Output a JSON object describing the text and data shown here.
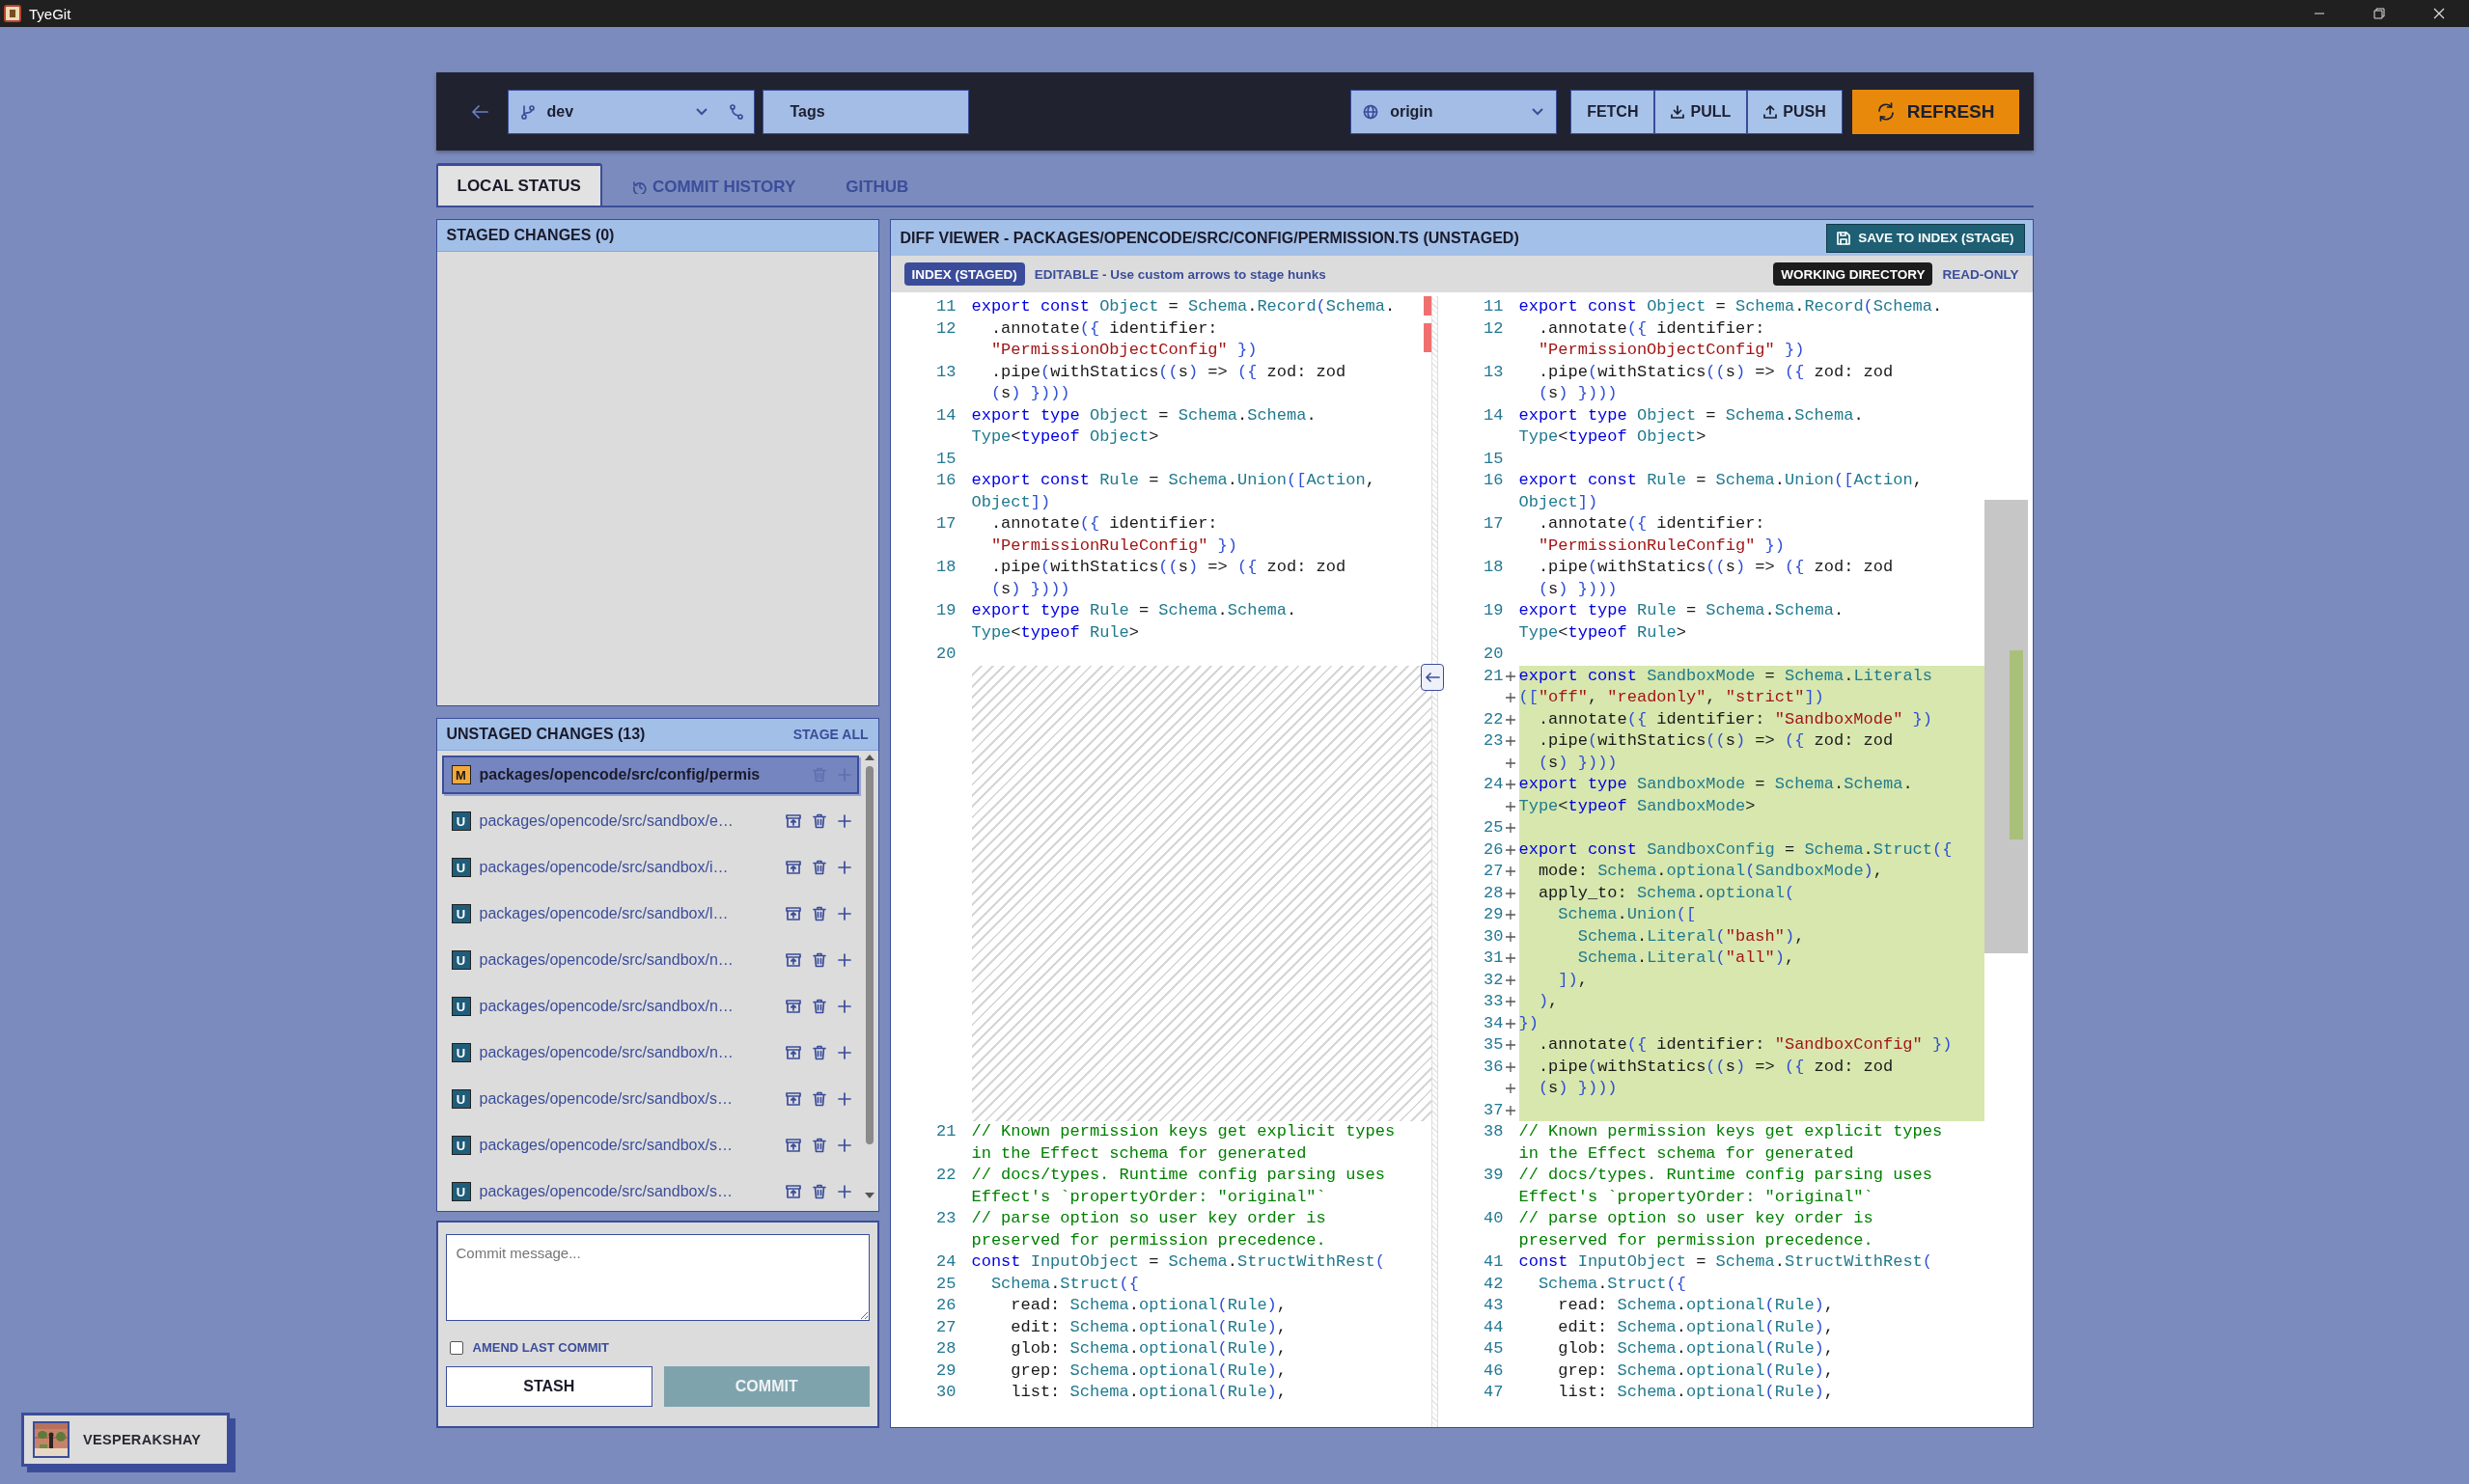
{
  "window": {
    "title": "TyeGit"
  },
  "toolbar": {
    "branch": "dev",
    "tags": "Tags",
    "remote": "origin",
    "actions": [
      {
        "label": "FETCH",
        "kind": "plain"
      },
      {
        "label": "PULL",
        "kind": "pull"
      },
      {
        "label": "PUSH",
        "kind": "push"
      },
      {
        "label": "REFRESH",
        "kind": "refresh"
      }
    ]
  },
  "tabs": [
    {
      "label": "LOCAL STATUS",
      "kind": "plain",
      "selected": true
    },
    {
      "label": "COMMIT HISTORY",
      "kind": "history",
      "selected": false
    },
    {
      "label": "GITHUB",
      "kind": "plain",
      "selected": false
    }
  ],
  "staged": {
    "title": "STAGED CHANGES (0)"
  },
  "unstaged": {
    "title": "UNSTAGED CHANGES (13)",
    "action": "STAGE ALL",
    "files": [
      {
        "status": "M",
        "kind": "modified",
        "path": "packages/opencode/src/config/permis",
        "selected": true
      },
      {
        "status": "U",
        "kind": "untracked",
        "path": "packages/opencode/src/sandbox/e…",
        "selected": false
      },
      {
        "status": "U",
        "kind": "untracked",
        "path": "packages/opencode/src/sandbox/i…",
        "selected": false
      },
      {
        "status": "U",
        "kind": "untracked",
        "path": "packages/opencode/src/sandbox/l…",
        "selected": false
      },
      {
        "status": "U",
        "kind": "untracked",
        "path": "packages/opencode/src/sandbox/n…",
        "selected": false
      },
      {
        "status": "U",
        "kind": "untracked",
        "path": "packages/opencode/src/sandbox/n…",
        "selected": false
      },
      {
        "status": "U",
        "kind": "untracked",
        "path": "packages/opencode/src/sandbox/n…",
        "selected": false
      },
      {
        "status": "U",
        "kind": "untracked",
        "path": "packages/opencode/src/sandbox/s…",
        "selected": false
      },
      {
        "status": "U",
        "kind": "untracked",
        "path": "packages/opencode/src/sandbox/s…",
        "selected": false
      },
      {
        "status": "U",
        "kind": "untracked",
        "path": "packages/opencode/src/sandbox/s…",
        "selected": false
      }
    ]
  },
  "commit": {
    "placeholder": "Commit message...",
    "amend": {
      "label": "AMEND LAST COMMIT",
      "checked": false
    },
    "stash": "STASH",
    "submit": {
      "label": "COMMIT",
      "disabled": true
    }
  },
  "diff": {
    "title": "DIFF VIEWER - PACKAGES/OPENCODE/SRC/CONFIG/PERMISSION.TS (UNSTAGED)",
    "save": "SAVE TO INDEX (STAGE)",
    "left": {
      "badge": "INDEX (STAGED)",
      "note": "EDITABLE - Use custom arrows to stage hunks",
      "lines": [
        {
          "num": "11",
          "kind": "context",
          "rows": [
            "export const Object = Schema.Record(Schema."
          ]
        },
        {
          "num": "12",
          "kind": "context",
          "rows": [
            "  .annotate({ identifier:",
            "  \"PermissionObjectConfig\" })"
          ]
        },
        {
          "num": "13",
          "kind": "context",
          "rows": [
            "  .pipe(withStatics((s) => ({ zod: zod",
            "  (s) })))"
          ]
        },
        {
          "num": "14",
          "kind": "context",
          "rows": [
            "export type Object = Schema.Schema.",
            "Type<typeof Object>"
          ]
        },
        {
          "num": "15",
          "kind": "context"
        },
        {
          "num": "16",
          "kind": "context",
          "rows": [
            "export const Rule = Schema.Union([Action,",
            "Object])"
          ]
        },
        {
          "num": "17",
          "kind": "context",
          "rows": [
            "  .annotate({ identifier:",
            "  \"PermissionRuleConfig\" })"
          ]
        },
        {
          "num": "18",
          "kind": "context",
          "rows": [
            "  .pipe(withStatics((s) => ({ zod: zod",
            "  (s) })))"
          ]
        },
        {
          "num": "19",
          "kind": "context",
          "rows": [
            "export type Rule = Schema.Schema.",
            "Type<typeof Rule>"
          ]
        },
        {
          "num": "20",
          "kind": "context"
        },
        {
          "kind": "filler"
        },
        {
          "num": "21",
          "kind": "context",
          "rows": [
            "// Known permission keys get explicit types",
            "in the Effect schema for generated"
          ]
        },
        {
          "num": "22",
          "kind": "context",
          "rows": [
            "// docs/types. Runtime config parsing uses",
            "Effect's `propertyOrder: \"original\"`"
          ]
        },
        {
          "num": "23",
          "kind": "context",
          "rows": [
            "// parse option so user key order is",
            "preserved for permission precedence."
          ]
        },
        {
          "num": "24",
          "kind": "context",
          "rows": [
            "const InputObject = Schema.StructWithRest("
          ]
        },
        {
          "num": "25",
          "kind": "context",
          "rows": [
            "  Schema.Struct({"
          ]
        },
        {
          "num": "26",
          "kind": "context",
          "rows": [
            "    read: Schema.optional(Rule),"
          ]
        },
        {
          "num": "27",
          "kind": "context",
          "rows": [
            "    edit: Schema.optional(Rule),"
          ]
        },
        {
          "num": "28",
          "kind": "context",
          "rows": [
            "    glob: Schema.optional(Rule),"
          ]
        },
        {
          "num": "29",
          "kind": "context",
          "rows": [
            "    grep: Schema.optional(Rule),"
          ]
        },
        {
          "num": "30",
          "kind": "context",
          "rows": [
            "    list: Schema.optional(Rule),"
          ]
        }
      ]
    },
    "right": {
      "badge": "WORKING DIRECTORY",
      "note": "READ-ONLY",
      "lines": [
        {
          "num": "11",
          "kind": "context",
          "rows": [
            "export const Object = Schema.Record(Schema."
          ]
        },
        {
          "num": "12",
          "kind": "context",
          "rows": [
            "  .annotate({ identifier:",
            "  \"PermissionObjectConfig\" })"
          ]
        },
        {
          "num": "13",
          "kind": "context",
          "rows": [
            "  .pipe(withStatics((s) => ({ zod: zod",
            "  (s) })))"
          ]
        },
        {
          "num": "14",
          "kind": "context",
          "rows": [
            "export type Object = Schema.Schema.",
            "Type<typeof Object>"
          ]
        },
        {
          "num": "15",
          "kind": "context"
        },
        {
          "num": "16",
          "kind": "context",
          "rows": [
            "export const Rule = Schema.Union([Action,",
            "Object])"
          ]
        },
        {
          "num": "17",
          "kind": "context",
          "rows": [
            "  .annotate({ identifier:",
            "  \"PermissionRuleConfig\" })"
          ]
        },
        {
          "num": "18",
          "kind": "context",
          "rows": [
            "  .pipe(withStatics((s) => ({ zod: zod",
            "  (s) })))"
          ]
        },
        {
          "num": "19",
          "kind": "context",
          "rows": [
            "export type Rule = Schema.Schema.",
            "Type<typeof Rule>"
          ]
        },
        {
          "num": "20",
          "kind": "context"
        },
        {
          "num": "21",
          "kind": "added",
          "rows": [
            "export const SandboxMode = Schema.Literals",
            "([\"off\", \"readonly\", \"strict\"])"
          ]
        },
        {
          "num": "22",
          "kind": "added",
          "rows": [
            "  .annotate({ identifier: \"SandboxMode\" })"
          ]
        },
        {
          "num": "23",
          "kind": "added",
          "rows": [
            "  .pipe(withStatics((s) => ({ zod: zod",
            "  (s) })))"
          ]
        },
        {
          "num": "24",
          "kind": "added",
          "rows": [
            "export type SandboxMode = Schema.Schema.",
            "Type<typeof SandboxMode>"
          ]
        },
        {
          "num": "25",
          "kind": "added"
        },
        {
          "num": "26",
          "kind": "added",
          "rows": [
            "export const SandboxConfig = Schema.Struct({"
          ]
        },
        {
          "num": "27",
          "kind": "added",
          "rows": [
            "  mode: Schema.optional(SandboxMode),"
          ]
        },
        {
          "num": "28",
          "kind": "added",
          "rows": [
            "  apply_to: Schema.optional("
          ]
        },
        {
          "num": "29",
          "kind": "added",
          "rows": [
            "    Schema.Union(["
          ]
        },
        {
          "num": "30",
          "kind": "added",
          "rows": [
            "      Schema.Literal(\"bash\"),"
          ]
        },
        {
          "num": "31",
          "kind": "added",
          "rows": [
            "      Schema.Literal(\"all\"),"
          ]
        },
        {
          "num": "32",
          "kind": "added",
          "rows": [
            "    ]),"
          ]
        },
        {
          "num": "33",
          "kind": "added",
          "rows": [
            "  ),"
          ]
        },
        {
          "num": "34",
          "kind": "added",
          "rows": [
            "})"
          ]
        },
        {
          "num": "35",
          "kind": "added",
          "rows": [
            "  .annotate({ identifier: \"SandboxConfig\" })"
          ]
        },
        {
          "num": "36",
          "kind": "added",
          "rows": [
            "  .pipe(withStatics((s) => ({ zod: zod",
            "  (s) })))"
          ]
        },
        {
          "num": "37",
          "kind": "added"
        },
        {
          "num": "38",
          "kind": "context",
          "rows": [
            "// Known permission keys get explicit types",
            "in the Effect schema for generated"
          ]
        },
        {
          "num": "39",
          "kind": "context",
          "rows": [
            "// docs/types. Runtime config parsing uses",
            "Effect's `propertyOrder: \"original\"`"
          ]
        },
        {
          "num": "40",
          "kind": "context",
          "rows": [
            "// parse option so user key order is",
            "preserved for permission precedence."
          ]
        },
        {
          "num": "41",
          "kind": "context",
          "rows": [
            "const InputObject = Schema.StructWithRest("
          ]
        },
        {
          "num": "42",
          "kind": "context",
          "rows": [
            "  Schema.Struct({"
          ]
        },
        {
          "num": "43",
          "kind": "context",
          "rows": [
            "    read: Schema.optional(Rule),"
          ]
        },
        {
          "num": "44",
          "kind": "context",
          "rows": [
            "    edit: Schema.optional(Rule),"
          ]
        },
        {
          "num": "45",
          "kind": "context",
          "rows": [
            "    glob: Schema.optional(Rule),"
          ]
        },
        {
          "num": "46",
          "kind": "context",
          "rows": [
            "    grep: Schema.optional(Rule),"
          ]
        },
        {
          "num": "47",
          "kind": "context",
          "rows": [
            "    list: Schema.optional(Rule),"
          ]
        }
      ]
    }
  },
  "user": {
    "name": "VESPERAKSHAY"
  }
}
